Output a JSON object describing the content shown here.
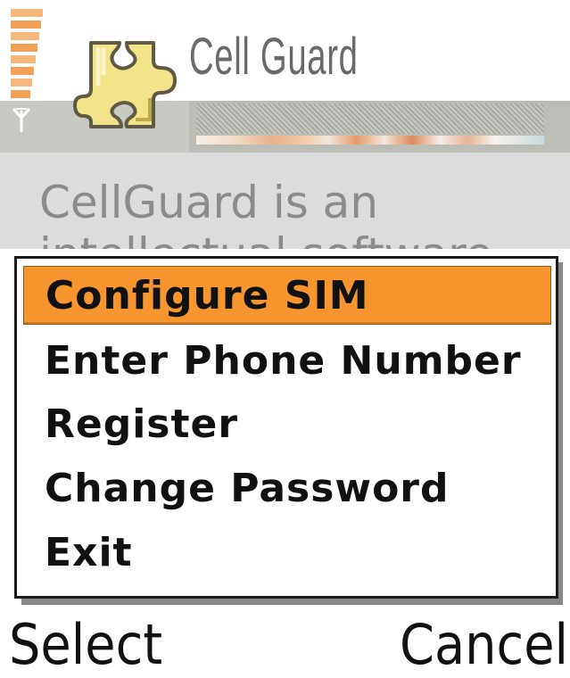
{
  "app": {
    "title": "Cell Guard",
    "icon": "puzzle-piece-icon",
    "accent_color": "#f7962e"
  },
  "status": {
    "signal_icon": "signal-strength-icon",
    "antenna_icon": "antenna-icon"
  },
  "body": {
    "line1": "CellGuard is an",
    "line2": "intellectual software"
  },
  "menu": {
    "selected_index": 0,
    "items": [
      {
        "label": "Configure SIM"
      },
      {
        "label": "Enter Phone Number"
      },
      {
        "label": "Register"
      },
      {
        "label": "Change Password"
      },
      {
        "label": "Exit"
      }
    ]
  },
  "softkeys": {
    "left": "Select",
    "right": "Cancel"
  }
}
